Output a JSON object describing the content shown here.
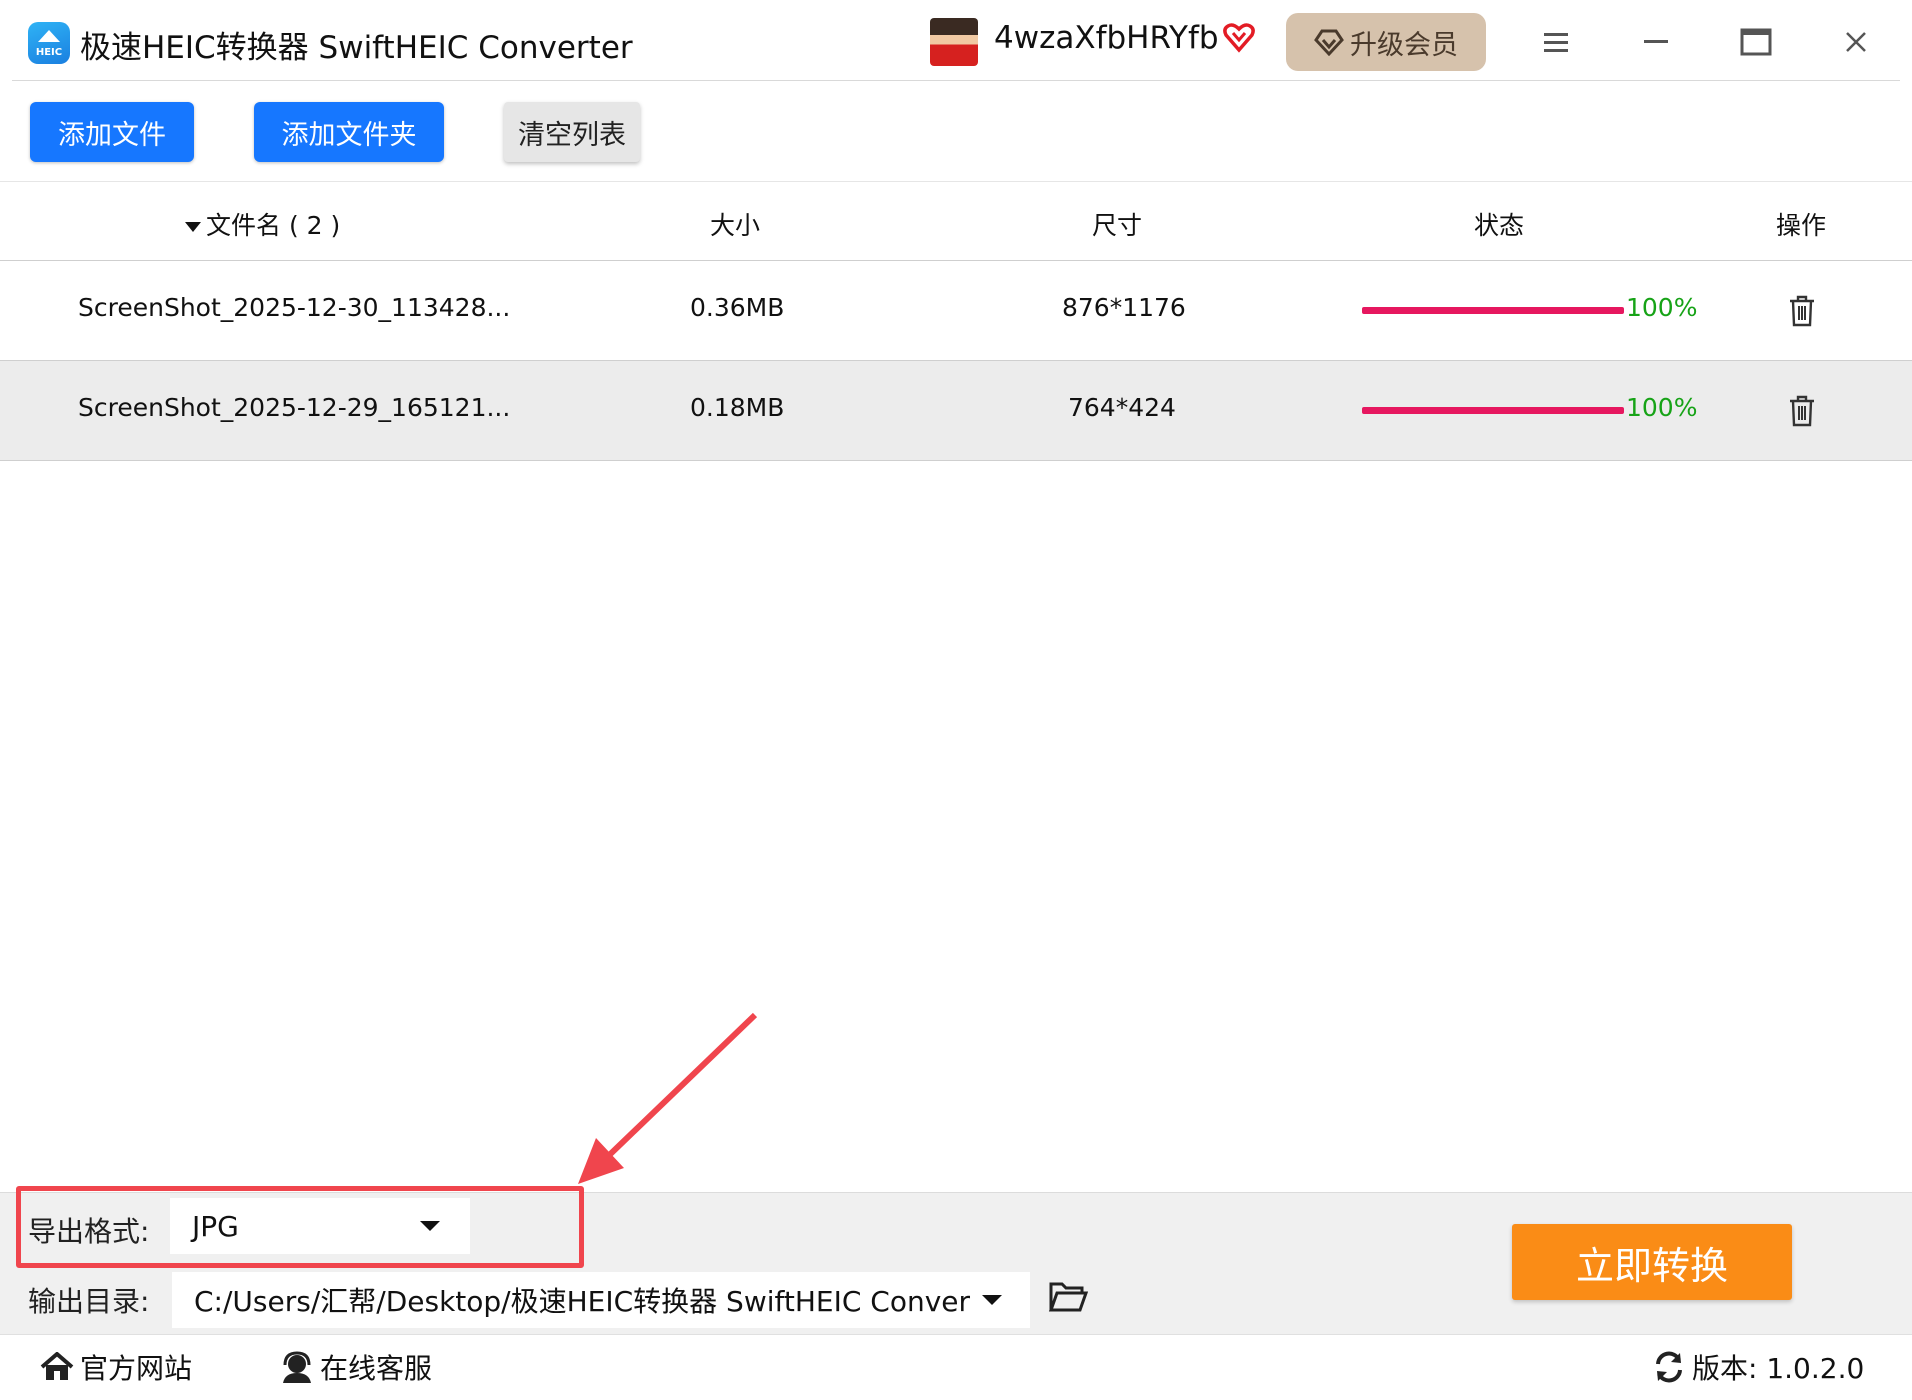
{
  "window": {
    "title": "极速HEIC转换器 SwiftHEIC Converter",
    "logo_text": "HEIC",
    "username": "4wzaXfbHRYfb",
    "upgrade_label": "升级会员"
  },
  "toolbar": {
    "add_file": "添加文件",
    "add_folder": "添加文件夹",
    "clear_list": "清空列表"
  },
  "table": {
    "headers": {
      "filename": "文件名 ( 2 )",
      "size": "大小",
      "dimensions": "尺寸",
      "status": "状态",
      "action": "操作"
    },
    "rows": [
      {
        "filename": "ScreenShot_2025-12-30_113428...",
        "size": "0.36MB",
        "dimensions": "876*1176",
        "progress_pct": 100,
        "status_text": "100%"
      },
      {
        "filename": "ScreenShot_2025-12-29_165121...",
        "size": "0.18MB",
        "dimensions": "764*424",
        "progress_pct": 100,
        "status_text": "100%"
      }
    ]
  },
  "bottom": {
    "format_label": "导出格式:",
    "format_value": "JPG",
    "output_label": "输出目录:",
    "output_value": "C:/Users/汇帮/Desktop/极速HEIC转换器 SwiftHEIC Conver",
    "convert_label": "立即转换"
  },
  "footer": {
    "website": "官方网站",
    "support": "在线客服",
    "version": "版本: 1.0.2.0"
  },
  "colors": {
    "primary": "#1677ff",
    "convert": "#fa8c16",
    "progress": "#e6175f",
    "success": "#17a317",
    "annotation": "#f0454d",
    "upgrade_bg": "#d6c2ac"
  }
}
